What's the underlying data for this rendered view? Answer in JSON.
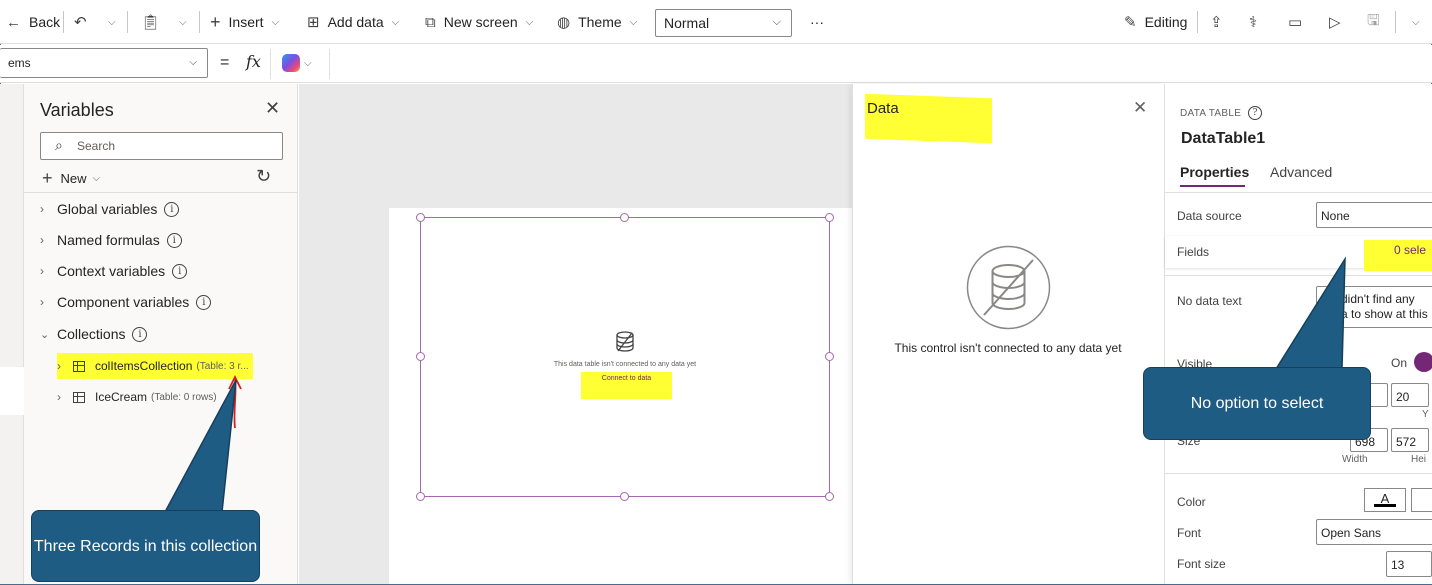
{
  "toolbar": {
    "back_label": "Back",
    "insert_label": "Insert",
    "add_data_label": "Add data",
    "new_screen_label": "New screen",
    "theme_label": "Theme",
    "mode_value": "Normal",
    "more_label": "···",
    "editing_label": "Editing"
  },
  "formula_bar": {
    "property_value": "ems",
    "equals": "=",
    "fx": "fx"
  },
  "variables_pane": {
    "title": "Variables",
    "search_placeholder": "Search",
    "new_label": "New",
    "groups": [
      {
        "label": "Global variables"
      },
      {
        "label": "Named formulas"
      },
      {
        "label": "Context variables"
      },
      {
        "label": "Component variables"
      },
      {
        "label": "Collections"
      }
    ],
    "collections": [
      {
        "name": "colItemsCollection",
        "meta": "(Table: 3 r..."
      },
      {
        "name": "IceCream",
        "meta": "(Table: 0 rows)"
      }
    ]
  },
  "canvas": {
    "control_message": "This data table isn't connected to any data yet",
    "control_link": "Connect to data"
  },
  "data_pane": {
    "title": "Data",
    "empty_message": "This control isn't connected to any data yet"
  },
  "properties": {
    "control_type": "DATA TABLE",
    "control_name": "DataTable1",
    "tabs": [
      "Properties",
      "Advanced"
    ],
    "data_source_label": "Data source",
    "data_source_value": "None",
    "fields_label": "Fields",
    "fields_value": "0 sele",
    "no_data_text_label": "No data text",
    "no_data_text_line1": "didn't find any",
    "no_data_text_line2": "a to show at this",
    "visible_label": "Visible",
    "visible_value": "On",
    "position_y": "20",
    "position_y_label": "Y",
    "size_label": "Size",
    "size_width": "698",
    "size_height": "572",
    "width_label": "Width",
    "height_label": "Hei",
    "color_label": "Color",
    "color_glyph": "A",
    "font_label": "Font",
    "font_value": "Open Sans",
    "font_size_label": "Font size",
    "font_size_value": "13"
  },
  "annotations": {
    "callout_records": "Three Records in this collection",
    "callout_no_option": "No option to select"
  },
  "colors": {
    "accent": "#742774",
    "highlight": "#ffff33",
    "callout_fill": "#1f5c83"
  }
}
